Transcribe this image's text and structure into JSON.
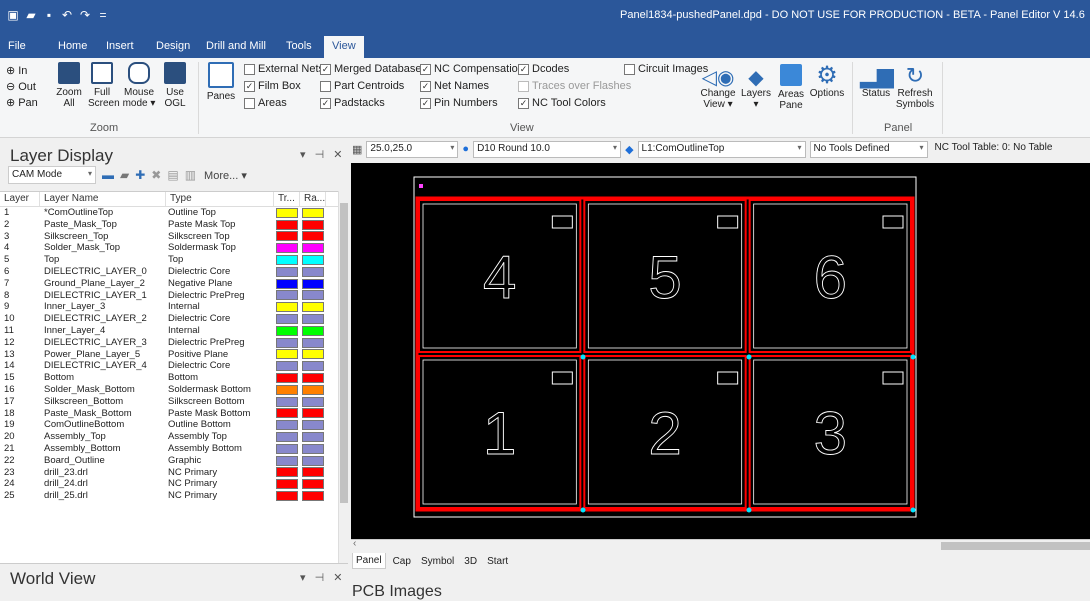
{
  "app": {
    "window_title": "Panel1834-pushedPanel.dpd - DO NOT USE FOR PRODUCTION - BETA - Panel Editor  V 14.6"
  },
  "quick_access": [
    {
      "name": "app-icon",
      "glyph": "▣"
    },
    {
      "name": "open-icon",
      "glyph": "▰"
    },
    {
      "name": "save-icon",
      "glyph": "▪"
    },
    {
      "name": "undo-icon",
      "glyph": "↶"
    },
    {
      "name": "redo-icon",
      "glyph": "↷"
    },
    {
      "name": "customize-icon",
      "glyph": "="
    }
  ],
  "tabs": [
    "File",
    "Home",
    "Insert",
    "Design",
    "Drill and Mill",
    "Tools",
    "View"
  ],
  "active_tab": "View",
  "ribbon": {
    "zoom": {
      "label": "Zoom",
      "in": "In",
      "out": "Out",
      "pan": "Pan",
      "zoom_all": "Zoom\nAll",
      "full_screen": "Full\nScreen",
      "mouse_mode": "Mouse\nmode ▾",
      "use_ogl": "Use\nOGL"
    },
    "view": {
      "label": "View",
      "panes": "Panes",
      "checkboxes": [
        {
          "label": "External Nets",
          "checked": false,
          "enabled": true
        },
        {
          "label": "Film Box",
          "checked": true,
          "enabled": true
        },
        {
          "label": "Areas",
          "checked": false,
          "enabled": true
        },
        {
          "label": "Merged Databases",
          "checked": true,
          "enabled": true
        },
        {
          "label": "Part Centroids",
          "checked": false,
          "enabled": true
        },
        {
          "label": "Padstacks",
          "checked": true,
          "enabled": true
        },
        {
          "label": "NC Compensation",
          "checked": true,
          "enabled": true
        },
        {
          "label": "Net Names",
          "checked": true,
          "enabled": true
        },
        {
          "label": "Pin Numbers",
          "checked": true,
          "enabled": true
        },
        {
          "label": "Dcodes",
          "checked": true,
          "enabled": true
        },
        {
          "label": "Traces over Flashes",
          "checked": false,
          "enabled": false
        },
        {
          "label": "NC Tool Colors",
          "checked": true,
          "enabled": true
        },
        {
          "label": "Circuit Images",
          "checked": false,
          "enabled": true
        }
      ],
      "change_view": "Change\nView ▾",
      "layers": "Layers\n▾",
      "areas_pane": "Areas\nPane",
      "options": "Options"
    },
    "panel": {
      "label": "Panel",
      "status": "Status",
      "refresh": "Refresh\nSymbols"
    }
  },
  "layer_display": {
    "title": "Layer Display",
    "cam_mode": "CAM Mode",
    "more": "More... ▾",
    "columns": [
      "Layer",
      "Layer Name",
      "Type",
      "Tr...",
      "Ra..."
    ],
    "rows": [
      {
        "n": "1",
        "name": "*ComOutlineTop",
        "type": "Outline Top",
        "c1": "#ffff00",
        "c2": "#ffff00"
      },
      {
        "n": "2",
        "name": "Paste_Mask_Top",
        "type": "Paste Mask Top",
        "c1": "#ff0000",
        "c2": "#ff0000"
      },
      {
        "n": "3",
        "name": "Silkscreen_Top",
        "type": "Silkscreen Top",
        "c1": "#ff0000",
        "c2": "#ff0000"
      },
      {
        "n": "4",
        "name": "Solder_Mask_Top",
        "type": "Soldermask Top",
        "c1": "#ff00ff",
        "c2": "#ff00ff"
      },
      {
        "n": "5",
        "name": "Top",
        "type": "Top",
        "c1": "#00ffff",
        "c2": "#00ffff"
      },
      {
        "n": "6",
        "name": "DIELECTRIC_LAYER_0",
        "type": "Dielectric Core",
        "c1": "#8888cc",
        "c2": "#8888cc"
      },
      {
        "n": "7",
        "name": "Ground_Plane_Layer_2",
        "type": "Negative Plane",
        "c1": "#0000ff",
        "c2": "#0000ff"
      },
      {
        "n": "8",
        "name": "DIELECTRIC_LAYER_1",
        "type": "Dielectric PrePreg",
        "c1": "#8888cc",
        "c2": "#8888cc"
      },
      {
        "n": "9",
        "name": "Inner_Layer_3",
        "type": "Internal",
        "c1": "#ffff00",
        "c2": "#ffff00"
      },
      {
        "n": "10",
        "name": "DIELECTRIC_LAYER_2",
        "type": "Dielectric Core",
        "c1": "#8888cc",
        "c2": "#8888cc"
      },
      {
        "n": "11",
        "name": "Inner_Layer_4",
        "type": "Internal",
        "c1": "#00ff00",
        "c2": "#00ff00"
      },
      {
        "n": "12",
        "name": "DIELECTRIC_LAYER_3",
        "type": "Dielectric PrePreg",
        "c1": "#8888cc",
        "c2": "#8888cc"
      },
      {
        "n": "13",
        "name": "Power_Plane_Layer_5",
        "type": "Positive Plane",
        "c1": "#ffff00",
        "c2": "#ffff00"
      },
      {
        "n": "14",
        "name": "DIELECTRIC_LAYER_4",
        "type": "Dielectric Core",
        "c1": "#8888cc",
        "c2": "#8888cc"
      },
      {
        "n": "15",
        "name": "Bottom",
        "type": "Bottom",
        "c1": "#ff0000",
        "c2": "#ff0000"
      },
      {
        "n": "16",
        "name": "Solder_Mask_Bottom",
        "type": "Soldermask Bottom",
        "c1": "#ff8000",
        "c2": "#ff8000"
      },
      {
        "n": "17",
        "name": "Silkscreen_Bottom",
        "type": "Silkscreen Bottom",
        "c1": "#8888cc",
        "c2": "#8888cc"
      },
      {
        "n": "18",
        "name": "Paste_Mask_Bottom",
        "type": "Paste Mask Bottom",
        "c1": "#ff0000",
        "c2": "#ff0000"
      },
      {
        "n": "19",
        "name": "ComOutlineBottom",
        "type": "Outline Bottom",
        "c1": "#8888cc",
        "c2": "#8888cc"
      },
      {
        "n": "20",
        "name": "Assembly_Top",
        "type": "Assembly Top",
        "c1": "#8888cc",
        "c2": "#8888cc"
      },
      {
        "n": "21",
        "name": "Assembly_Bottom",
        "type": "Assembly Bottom",
        "c1": "#8888cc",
        "c2": "#8888cc"
      },
      {
        "n": "22",
        "name": "Board_Outline",
        "type": "Graphic",
        "c1": "#8888cc",
        "c2": "#8888cc"
      },
      {
        "n": "23",
        "name": "drill_23.drl",
        "type": "NC Primary",
        "c1": "#ff0000",
        "c2": "#ff0000"
      },
      {
        "n": "24",
        "name": "drill_24.drl",
        "type": "NC Primary",
        "c1": "#ff0000",
        "c2": "#ff0000"
      },
      {
        "n": "25",
        "name": "drill_25.drl",
        "type": "NC Primary",
        "c1": "#ff0000",
        "c2": "#ff0000"
      }
    ]
  },
  "world_view": {
    "title": "World View"
  },
  "toolbar": {
    "grid": "25.0,25.0",
    "dcode": "D10  Round 10.0",
    "layer": "L1:ComOutlineTop",
    "tools": "No Tools Defined",
    "nc_table": "NC Tool Table: 0: No Table"
  },
  "panel_boards": [
    "4",
    "5",
    "6",
    "1",
    "2",
    "3"
  ],
  "bottom_tabs": [
    "Panel",
    "Cap",
    "Symbol",
    "3D",
    "Start"
  ],
  "active_bottom_tab": "Panel",
  "pcb_images": "PCB Images",
  "colors": {
    "accent": "#2b579a",
    "board_outline": "#ff0000",
    "film_box": "#ffffff"
  }
}
